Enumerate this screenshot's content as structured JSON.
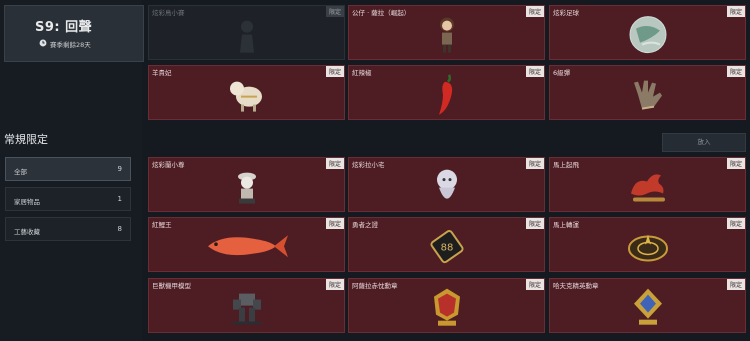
{
  "season": {
    "title": "S9: 回聲",
    "subtitle": "賽季剩餘28天"
  },
  "section_title": "常規限定",
  "categories": [
    {
      "label": "全部",
      "count": "9",
      "active": true
    },
    {
      "label": "家居物品",
      "count": "1",
      "active": false
    },
    {
      "label": "工藝收藏",
      "count": "8",
      "active": false
    }
  ],
  "put_button": "放入",
  "tag_text": "限定",
  "top_items": [
    {
      "name": "炫彩鳥小賽",
      "icon": "dark-figure-icon",
      "locked": true
    },
    {
      "name": "公仔 · 薩拉（崛起）",
      "icon": "doll-figure-icon"
    },
    {
      "name": "炫彩足球",
      "icon": "soccer-ball-icon"
    },
    {
      "name": "羊貴妃",
      "icon": "sheep-figure-icon"
    },
    {
      "name": "紅辣椒",
      "icon": "red-pepper-icon"
    },
    {
      "name": "6級彈",
      "icon": "hand-gesture-icon"
    }
  ],
  "items": [
    {
      "name": "炫彩蘭小尊",
      "icon": "small-statue-icon"
    },
    {
      "name": "炫彩拉小宅",
      "icon": "ghost-figure-icon"
    },
    {
      "name": "馬上起飛",
      "icon": "red-horse-icon"
    },
    {
      "name": "紅鯉王",
      "icon": "red-carp-icon"
    },
    {
      "name": "勇者之證",
      "icon": "hero-badge-icon"
    },
    {
      "name": "馬上轉運",
      "icon": "golden-compass-icon"
    },
    {
      "name": "巨獸機甲模型",
      "icon": "mech-model-icon"
    },
    {
      "name": "阿薩拉赤忱勳章",
      "icon": "red-medal-icon"
    },
    {
      "name": "哈夫克精英勳章",
      "icon": "blue-medal-icon"
    }
  ]
}
